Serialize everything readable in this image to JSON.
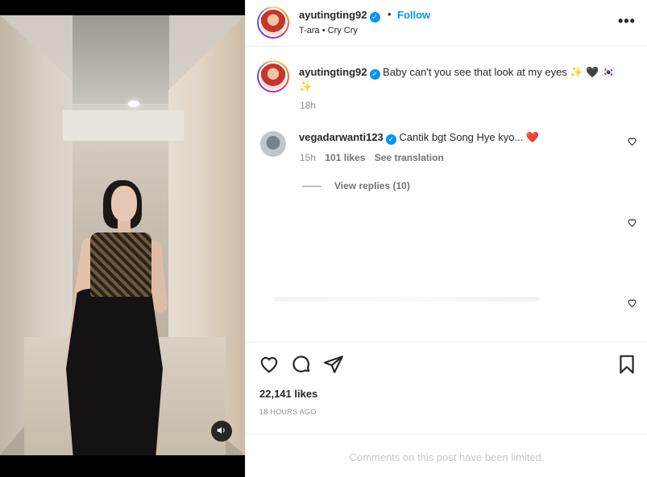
{
  "post": {
    "username": "ayutingting92",
    "audio": "T-ara • Cry Cry",
    "follow_label": "Follow",
    "dot": "•",
    "more_label": "•••"
  },
  "caption": {
    "username": "ayutingting92",
    "text": "Baby can't you see that look at my eyes ✨ 🖤 🇰🇷✨",
    "time": "18h"
  },
  "comment": {
    "username": "vegadarwanti123",
    "text": "Cantik bgt Song Hye kyo... ❤️",
    "time": "15h",
    "likes": "101 likes",
    "translate": "See translation",
    "view_replies": "View replies (10)"
  },
  "stats": {
    "likes": "22,141 likes",
    "ago": "18 HOURS AGO"
  },
  "footer": {
    "limited": "Comments on this post have been limited."
  },
  "icons": {
    "verified": "verified-badge-icon",
    "heart": "heart-icon",
    "comment": "comment-icon",
    "share": "share-icon",
    "save": "bookmark-icon",
    "sound": "speaker-icon"
  },
  "colors": {
    "accent": "#0095f6",
    "text": "#262626",
    "muted": "#8e8e8e"
  }
}
